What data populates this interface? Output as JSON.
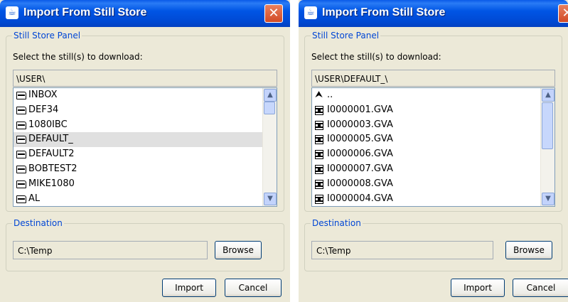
{
  "left_dialog": {
    "title": "Import From Still Store",
    "panel_label": "Still Store Panel",
    "prompt": "Select the still(s) to download:",
    "current_path": "\\USER\\",
    "items": [
      {
        "label": "INBOX",
        "icon": "folder-icon"
      },
      {
        "label": "DEF34",
        "icon": "folder-icon"
      },
      {
        "label": "1080IBC",
        "icon": "folder-icon"
      },
      {
        "label": "DEFAULT_",
        "icon": "folder-icon",
        "selected": true
      },
      {
        "label": "DEFAULT2",
        "icon": "folder-icon"
      },
      {
        "label": "BOBTEST2",
        "icon": "folder-icon"
      },
      {
        "label": "MIKE1080",
        "icon": "folder-icon"
      },
      {
        "label": "AL",
        "icon": "folder-icon"
      }
    ],
    "destination_label": "Destination",
    "destination_value": "C:\\Temp",
    "browse_label": "Browse",
    "import_label": "Import",
    "cancel_label": "Cancel"
  },
  "right_dialog": {
    "title": "Import From Still Store",
    "panel_label": "Still Store Panel",
    "prompt": "Select the still(s) to download:",
    "current_path": "\\USER\\DEFAULT_\\",
    "items": [
      {
        "label": "..",
        "icon": "parent-folder-icon"
      },
      {
        "label": "I0000001.GVA",
        "icon": "film-icon"
      },
      {
        "label": "I0000003.GVA",
        "icon": "film-icon"
      },
      {
        "label": "I0000005.GVA",
        "icon": "film-icon"
      },
      {
        "label": "I0000006.GVA",
        "icon": "film-icon"
      },
      {
        "label": "I0000007.GVA",
        "icon": "film-icon"
      },
      {
        "label": "I0000008.GVA",
        "icon": "film-icon"
      },
      {
        "label": "I0000004.GVA",
        "icon": "film-icon"
      }
    ],
    "destination_label": "Destination",
    "destination_value": "C:\\Temp",
    "browse_label": "Browse",
    "import_label": "Import",
    "cancel_label": "Cancel"
  },
  "colors": {
    "titlebar": "#0055e5",
    "close_button": "#d24a26",
    "group_label": "#0046d5",
    "dialog_bg": "#ece9d8",
    "selection": "#e0e0e0"
  }
}
